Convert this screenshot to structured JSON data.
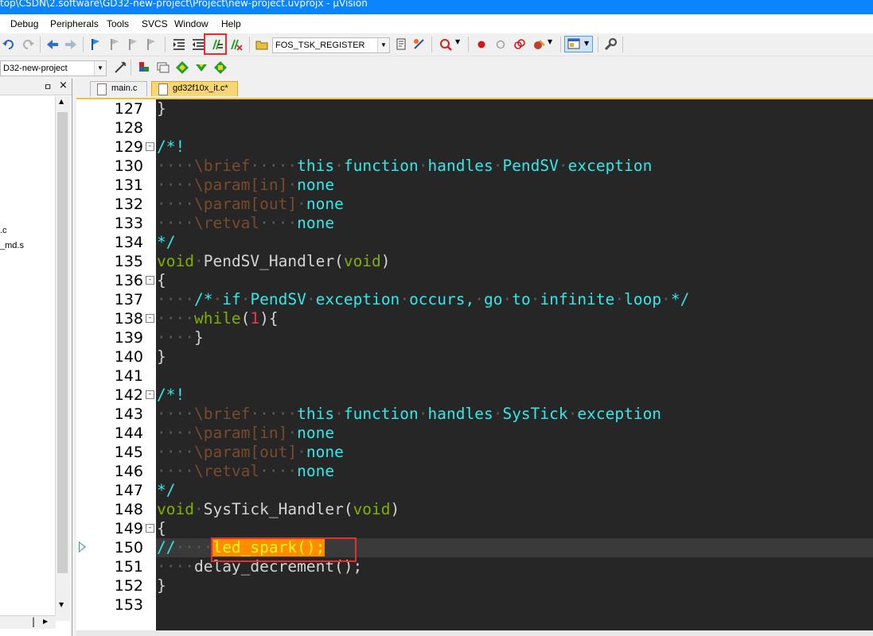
{
  "window": {
    "title": "top\\CSDN\\2.software\\GD32-new-project\\Project\\new-project.uvprojx - µVision"
  },
  "menu": [
    "Debug",
    "Peripherals",
    "Tools",
    "SVCS",
    "Window",
    "Help"
  ],
  "toolbar": {
    "target_combo": "FOS_TSK_REGISTER",
    "project_combo": "D32-new-project"
  },
  "project_pane": {
    "pin_label": "ㅁ",
    "close_label": "×",
    "items": [
      ".c",
      "_md.s"
    ]
  },
  "tabs": [
    {
      "label": "main.c",
      "active": false
    },
    {
      "label": "gd32f10x_it.c*",
      "active": true
    }
  ],
  "editor": {
    "current_line": 150,
    "lines": [
      {
        "n": "127",
        "fold": "",
        "parts": [
          [
            "c-brace",
            "}"
          ]
        ]
      },
      {
        "n": "128",
        "fold": "",
        "parts": []
      },
      {
        "n": "129",
        "fold": "-",
        "parts": [
          [
            "c-comment",
            "/*!"
          ]
        ]
      },
      {
        "n": "130",
        "fold": "",
        "parts": [
          [
            "c-dots",
            "····"
          ],
          [
            "c-doctag",
            "\\brief"
          ],
          [
            "c-dots",
            "·····"
          ],
          [
            "c-comment",
            "this"
          ],
          [
            "c-dots",
            "·"
          ],
          [
            "c-comment",
            "function"
          ],
          [
            "c-dots",
            "·"
          ],
          [
            "c-comment",
            "handles"
          ],
          [
            "c-dots",
            "·"
          ],
          [
            "c-comment",
            "PendSV"
          ],
          [
            "c-dots",
            "·"
          ],
          [
            "c-comment",
            "exception"
          ]
        ]
      },
      {
        "n": "131",
        "fold": "",
        "parts": [
          [
            "c-dots",
            "····"
          ],
          [
            "c-doctag",
            "\\param[in]"
          ],
          [
            "c-dots",
            "·"
          ],
          [
            "c-comment",
            "none"
          ]
        ]
      },
      {
        "n": "132",
        "fold": "",
        "parts": [
          [
            "c-dots",
            "····"
          ],
          [
            "c-doctag",
            "\\param[out]"
          ],
          [
            "c-dots",
            "·"
          ],
          [
            "c-comment",
            "none"
          ]
        ]
      },
      {
        "n": "133",
        "fold": "",
        "parts": [
          [
            "c-dots",
            "····"
          ],
          [
            "c-doctag",
            "\\retval"
          ],
          [
            "c-dots",
            "····"
          ],
          [
            "c-comment",
            "none"
          ]
        ]
      },
      {
        "n": "134",
        "fold": "",
        "parts": [
          [
            "c-comment",
            "*/"
          ]
        ]
      },
      {
        "n": "135",
        "fold": "",
        "parts": [
          [
            "c-kw",
            "void"
          ],
          [
            "c-dots",
            "·"
          ],
          [
            "c-fn",
            "PendSV_Handler("
          ],
          [
            "c-kw",
            "void"
          ],
          [
            "c-fn",
            ")"
          ]
        ]
      },
      {
        "n": "136",
        "fold": "-",
        "parts": [
          [
            "c-brace",
            "{"
          ]
        ]
      },
      {
        "n": "137",
        "fold": "",
        "parts": [
          [
            "c-dots",
            "····"
          ],
          [
            "c-comment",
            "/*"
          ],
          [
            "c-dots",
            "·"
          ],
          [
            "c-comment",
            "if"
          ],
          [
            "c-dots",
            "·"
          ],
          [
            "c-comment",
            "PendSV"
          ],
          [
            "c-dots",
            "·"
          ],
          [
            "c-comment",
            "exception"
          ],
          [
            "c-dots",
            "·"
          ],
          [
            "c-comment",
            "occurs,"
          ],
          [
            "c-dots",
            "·"
          ],
          [
            "c-comment",
            "go"
          ],
          [
            "c-dots",
            "·"
          ],
          [
            "c-comment",
            "to"
          ],
          [
            "c-dots",
            "·"
          ],
          [
            "c-comment",
            "infinite"
          ],
          [
            "c-dots",
            "·"
          ],
          [
            "c-comment",
            "loop"
          ],
          [
            "c-dots",
            "·"
          ],
          [
            "c-comment",
            "*/"
          ]
        ]
      },
      {
        "n": "138",
        "fold": "-",
        "parts": [
          [
            "c-dots",
            "····"
          ],
          [
            "c-kw",
            "while"
          ],
          [
            "c-fn",
            "("
          ],
          [
            "c-num",
            "1"
          ],
          [
            "c-fn",
            "){"
          ]
        ]
      },
      {
        "n": "139",
        "fold": "",
        "parts": [
          [
            "c-dots",
            "····"
          ],
          [
            "c-brace",
            "}"
          ]
        ]
      },
      {
        "n": "140",
        "fold": "",
        "parts": [
          [
            "c-brace",
            "}"
          ]
        ]
      },
      {
        "n": "141",
        "fold": "",
        "parts": []
      },
      {
        "n": "142",
        "fold": "-",
        "parts": [
          [
            "c-comment",
            "/*!"
          ]
        ]
      },
      {
        "n": "143",
        "fold": "",
        "parts": [
          [
            "c-dots",
            "····"
          ],
          [
            "c-doctag",
            "\\brief"
          ],
          [
            "c-dots",
            "·····"
          ],
          [
            "c-comment",
            "this"
          ],
          [
            "c-dots",
            "·"
          ],
          [
            "c-comment",
            "function"
          ],
          [
            "c-dots",
            "·"
          ],
          [
            "c-comment",
            "handles"
          ],
          [
            "c-dots",
            "·"
          ],
          [
            "c-comment",
            "SysTick"
          ],
          [
            "c-dots",
            "·"
          ],
          [
            "c-comment",
            "exception"
          ]
        ]
      },
      {
        "n": "144",
        "fold": "",
        "parts": [
          [
            "c-dots",
            "····"
          ],
          [
            "c-doctag",
            "\\param[in]"
          ],
          [
            "c-dots",
            "·"
          ],
          [
            "c-comment",
            "none"
          ]
        ]
      },
      {
        "n": "145",
        "fold": "",
        "parts": [
          [
            "c-dots",
            "····"
          ],
          [
            "c-doctag",
            "\\param[out]"
          ],
          [
            "c-dots",
            "·"
          ],
          [
            "c-comment",
            "none"
          ]
        ]
      },
      {
        "n": "146",
        "fold": "",
        "parts": [
          [
            "c-dots",
            "····"
          ],
          [
            "c-doctag",
            "\\retval"
          ],
          [
            "c-dots",
            "····"
          ],
          [
            "c-comment",
            "none"
          ]
        ]
      },
      {
        "n": "147",
        "fold": "",
        "parts": [
          [
            "c-comment",
            "*/"
          ]
        ]
      },
      {
        "n": "148",
        "fold": "",
        "parts": [
          [
            "c-kw",
            "void"
          ],
          [
            "c-dots",
            "·"
          ],
          [
            "c-fn",
            "SysTick_Handler("
          ],
          [
            "c-kw",
            "void"
          ],
          [
            "c-fn",
            ")"
          ]
        ]
      },
      {
        "n": "149",
        "fold": "-",
        "parts": [
          [
            "c-brace",
            "{"
          ]
        ]
      },
      {
        "n": "150",
        "fold": "",
        "parts": [
          [
            "c-comment",
            "//"
          ],
          [
            "c-dots",
            "····"
          ],
          [
            "hl-sel",
            "led_spark();"
          ]
        ]
      },
      {
        "n": "151",
        "fold": "",
        "parts": [
          [
            "c-dots",
            "····"
          ],
          [
            "c-fn",
            "delay_decrement();"
          ]
        ]
      },
      {
        "n": "152",
        "fold": "",
        "parts": [
          [
            "c-brace",
            "}"
          ]
        ]
      },
      {
        "n": "153",
        "fold": "",
        "parts": []
      }
    ]
  },
  "colors": {
    "editor_bg": "#262626",
    "comment": "#33e8e8",
    "keyword": "#80b000",
    "selection": "#ff8c00",
    "highlight_box": "#e03030"
  }
}
